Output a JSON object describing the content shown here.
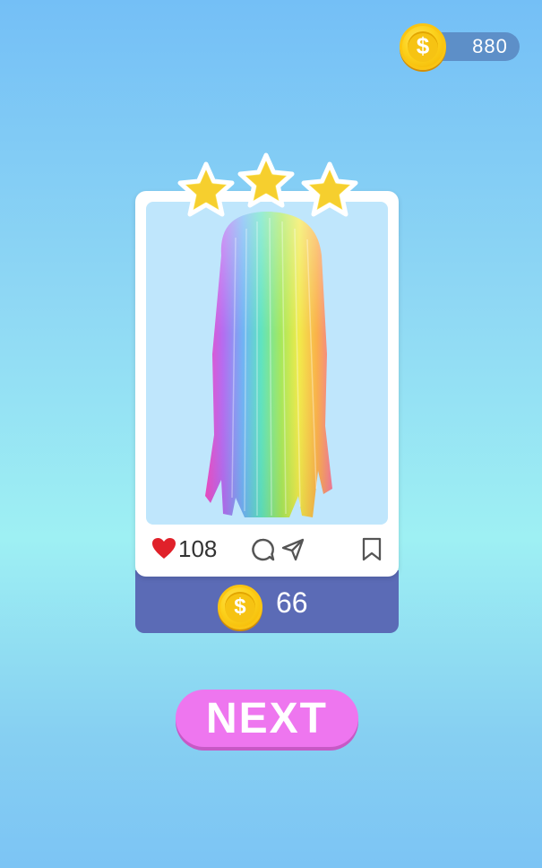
{
  "balance": {
    "coins": "880",
    "icon": "coin-icon"
  },
  "card": {
    "rating_stars": 3,
    "likes": "108",
    "reward": "66",
    "icons": [
      "heart-icon",
      "comment-icon",
      "share-icon",
      "bookmark-icon",
      "coin-icon"
    ]
  },
  "next_button": {
    "label": "NEXT"
  },
  "colors": {
    "accent_pink": "#ee76ef",
    "card_footer": "#5b6bb6",
    "coin_gold": "#f6c313",
    "heart_red": "#e0212a"
  }
}
